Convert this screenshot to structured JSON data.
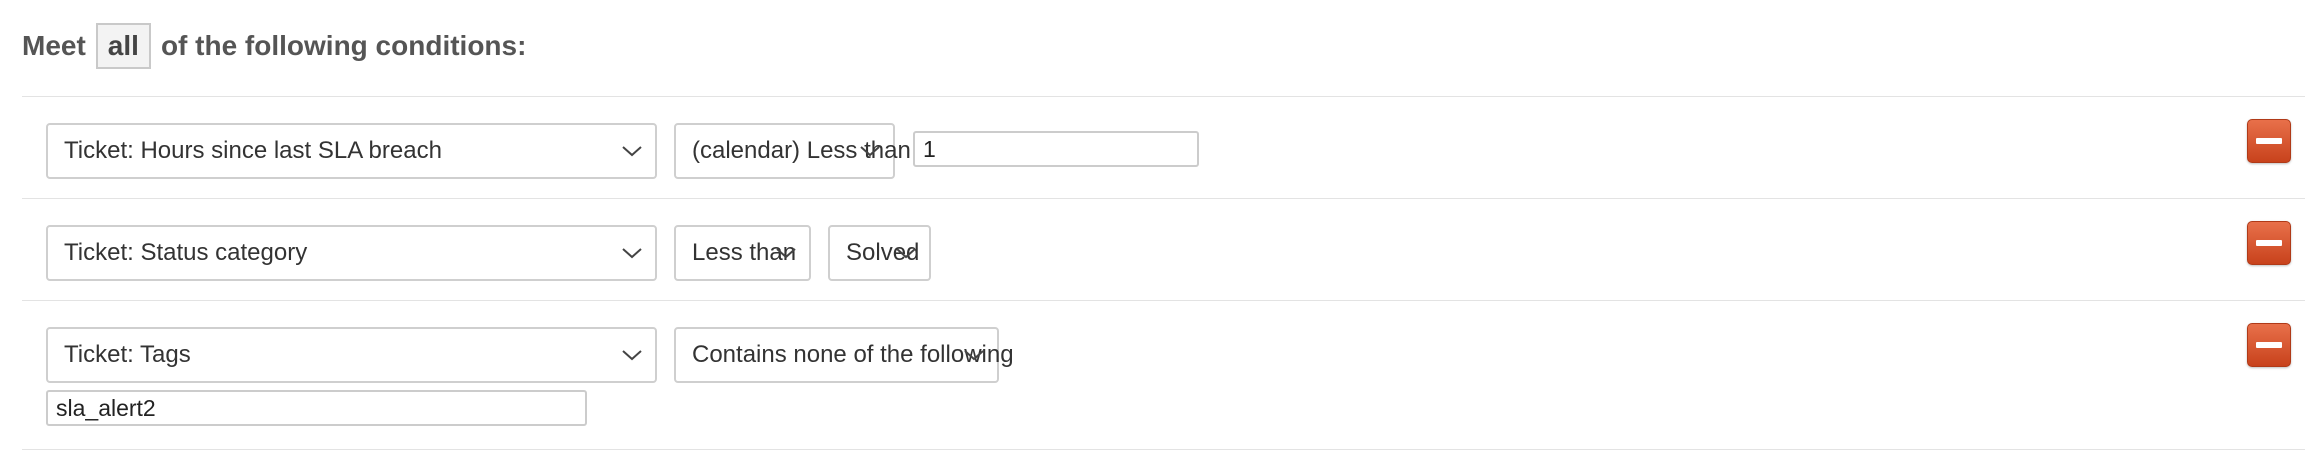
{
  "header": {
    "prefix": "Meet",
    "match_mode": "all",
    "suffix": "of the following conditions:"
  },
  "conditions": [
    {
      "field": "Ticket: Hours since last SLA breach",
      "operator": "(calendar) Less than",
      "value": "1",
      "icon": "minus-icon"
    },
    {
      "field": "Ticket: Status category",
      "operator": "Less than",
      "value": "Solved",
      "icon": "minus-icon"
    },
    {
      "field": "Ticket: Tags",
      "operator": "Contains none of the following",
      "value": "sla_alert2",
      "icon": "minus-icon"
    }
  ],
  "colors": {
    "remove_button": "#d4532b",
    "select_border": "#cfcfcf",
    "divider": "#e3e3e3"
  }
}
